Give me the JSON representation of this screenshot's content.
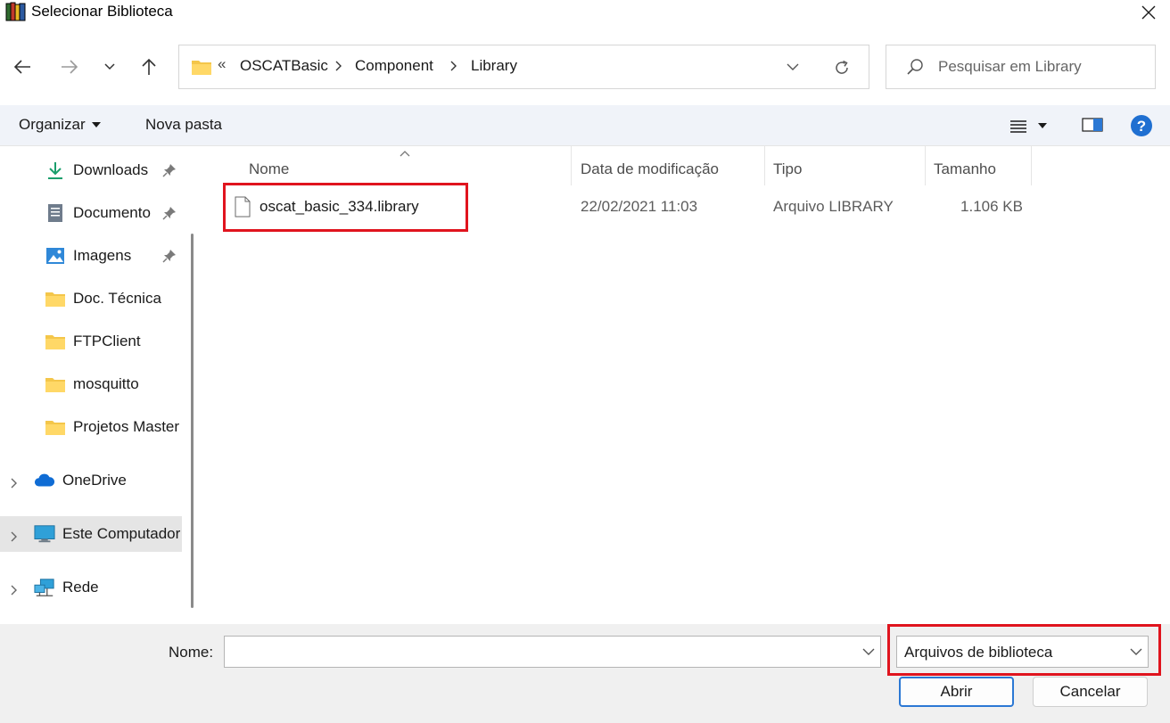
{
  "window": {
    "title": "Selecionar Biblioteca",
    "app_icon": "books-icon",
    "close_icon": "close-icon"
  },
  "navigation": {
    "back_icon": "arrow-left-icon",
    "forward_icon": "arrow-right-icon",
    "recent_icon": "chevron-down-icon",
    "up_icon": "arrow-up-icon",
    "address": {
      "overflow_marker": "«",
      "breadcrumbs": [
        "OSCATBasic",
        "Component",
        "Library"
      ],
      "dropdown_icon": "chevron-down-icon",
      "refresh_icon": "refresh-icon"
    },
    "search": {
      "placeholder": "Pesquisar em Library",
      "value": ""
    }
  },
  "toolbar": {
    "organize_label": "Organizar",
    "new_folder_label": "Nova pasta",
    "view_icon": "view-list-icon",
    "preview_icon": "preview-pane-icon",
    "help_icon": "help-icon"
  },
  "sidebar": {
    "items": [
      {
        "label": "Downloads",
        "icon": "download-icon",
        "pinned": true
      },
      {
        "label": "Documento",
        "icon": "documents-icon",
        "pinned": true
      },
      {
        "label": "Imagens",
        "icon": "pictures-icon",
        "pinned": true
      },
      {
        "label": "Doc. Técnica",
        "icon": "folder-icon"
      },
      {
        "label": "FTPClient",
        "icon": "folder-icon"
      },
      {
        "label": "mosquitto",
        "icon": "folder-icon"
      },
      {
        "label": "Projetos Master",
        "icon": "folder-icon"
      },
      {
        "label": "OneDrive",
        "icon": "cloud-icon",
        "expandable": true
      },
      {
        "label": "Este Computador",
        "icon": "computer-icon",
        "expandable": true,
        "selected": true
      },
      {
        "label": "Rede",
        "icon": "network-icon",
        "expandable": true
      }
    ]
  },
  "filelist": {
    "columns": [
      "Nome",
      "Data de modificação",
      "Tipo",
      "Tamanho"
    ],
    "sort_column": "Nome",
    "rows": [
      {
        "name": "oscat_basic_334.library",
        "modified": "22/02/2021 11:03",
        "type": "Arquivo LIBRARY",
        "size": "1.106 KB",
        "icon": "file-icon"
      }
    ]
  },
  "footer": {
    "name_label": "Nome:",
    "name_value": "",
    "file_type": "Arquivos de biblioteca",
    "open_label": "Abrir",
    "cancel_label": "Cancelar"
  },
  "colors": {
    "highlight": "#e0141e",
    "accent": "#2b78d4",
    "folder": "#f4c64a",
    "toolbar_bg": "#f0f3f9"
  }
}
